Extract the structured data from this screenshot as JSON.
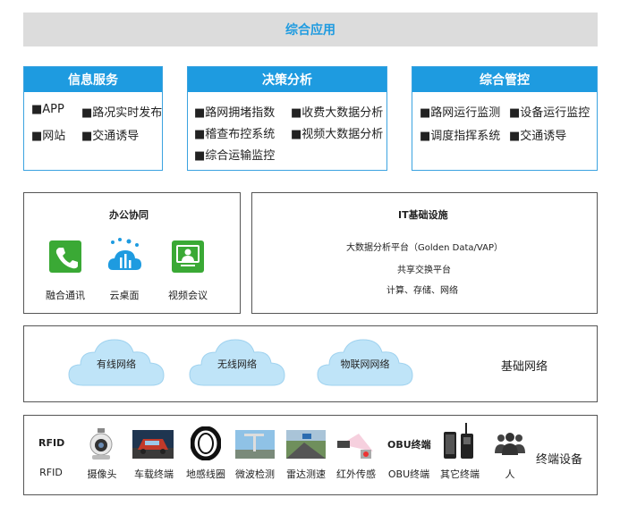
{
  "top": {
    "title": "综合应用"
  },
  "panels": {
    "info": {
      "title": "信息服务",
      "items": [
        "■APP",
        "■路况实时发布",
        "■网站",
        "■交通诱导"
      ]
    },
    "decision": {
      "title": "决策分析",
      "items": [
        "■路网拥堵指数",
        "■收费大数据分析",
        "■稽查布控系统",
        "■视频大数据分析",
        "■综合运输监控"
      ]
    },
    "manage": {
      "title": "综合管控",
      "items": [
        "■路网运行监测",
        "■设备运行监控",
        "■调度指挥系统",
        "■交通诱导"
      ]
    }
  },
  "office": {
    "title": "办公协同",
    "apps": [
      {
        "label": "融合通讯",
        "icon": "phone-icon",
        "color": "#3aa935"
      },
      {
        "label": "云桌面",
        "icon": "cloud-desktop-icon",
        "color": "#1e9be0"
      },
      {
        "label": "视频会议",
        "icon": "video-conference-icon",
        "color": "#3aa935"
      }
    ]
  },
  "it": {
    "title": "IT基础设施",
    "lines": [
      "大数据分析平台（Golden Data/VAP）",
      "共享交换平台",
      "计算、存储、网络"
    ]
  },
  "network": {
    "label": "基础网络",
    "clouds": [
      "有线网络",
      "无线网络",
      "物联网网络"
    ]
  },
  "terminal": {
    "label": "终端设备",
    "devices": [
      {
        "top": "RFID",
        "label": "RFID",
        "icon": "rfid-text"
      },
      {
        "label": "摄像头",
        "icon": "camera-icon"
      },
      {
        "label": "车载终端",
        "icon": "vehicle-photo-icon"
      },
      {
        "label": "地感线圈",
        "icon": "loop-coil-icon"
      },
      {
        "label": "微波检测",
        "icon": "microwave-photo-icon"
      },
      {
        "label": "雷达测速",
        "icon": "radar-photo-icon"
      },
      {
        "label": "红外传感",
        "icon": "infrared-icon"
      },
      {
        "top": "OBU终端",
        "label": "OBU终端",
        "icon": "obu-text"
      },
      {
        "label": "其它终端",
        "icon": "phone-radio-icon"
      },
      {
        "label": "人",
        "icon": "people-icon"
      }
    ]
  },
  "colors": {
    "accent": "#1e9be0",
    "green": "#3aa935",
    "bar": "#dcdcdc"
  }
}
